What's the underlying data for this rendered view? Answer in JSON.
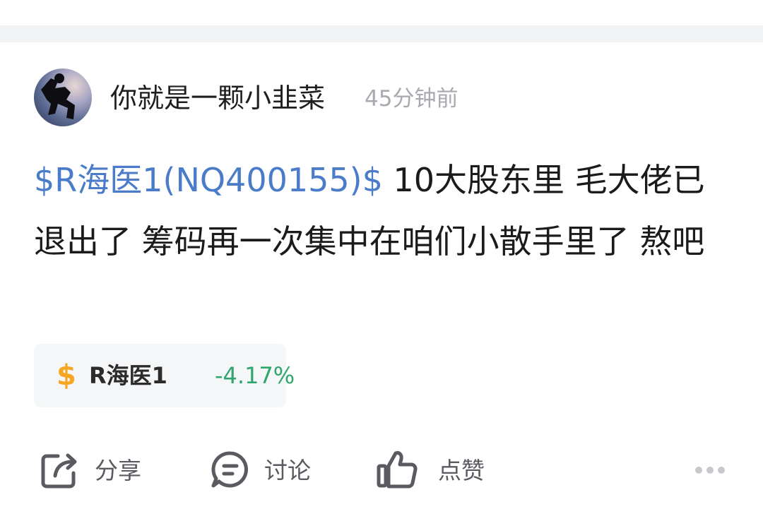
{
  "post": {
    "author": "你就是一颗小韭菜",
    "time_ago": "45分钟前",
    "mention": "$R海医1(NQ400155)$",
    "body_text": " 10大股东里 毛大佬已退出了 筹码再一次集中在咱们小散手里了 熬吧"
  },
  "stock_chip": {
    "symbol": "$",
    "name": "R海医1",
    "change": "-4.17%",
    "change_color": "#2fa66b"
  },
  "actions": {
    "share_label": "分享",
    "discuss_label": "讨论",
    "like_label": "点赞"
  },
  "colors": {
    "mention": "#4a7cc9",
    "dollar": "#f5a623"
  }
}
